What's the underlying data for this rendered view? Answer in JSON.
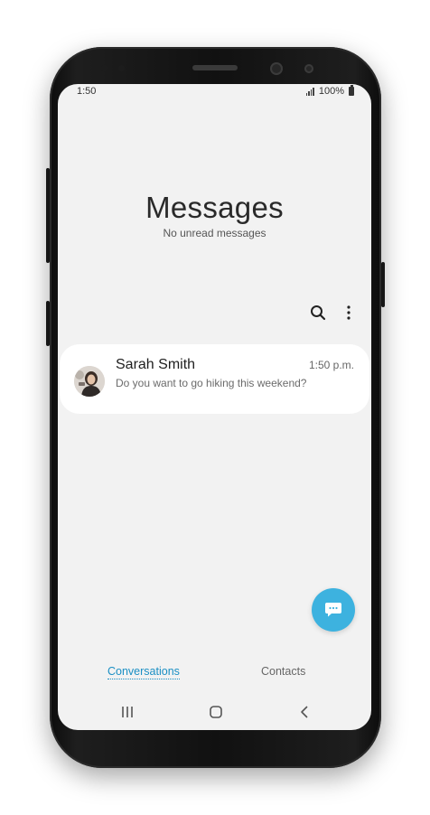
{
  "status_bar": {
    "time": "1:50",
    "battery": "100%"
  },
  "header": {
    "title": "Messages",
    "subtitle": "No unread messages"
  },
  "toolbar": {
    "search_icon": "search-icon",
    "more_icon": "more-vert-icon"
  },
  "conversations": [
    {
      "name": "Sarah Smith",
      "preview": "Do you want to go hiking this weekend?",
      "time": "1:50 p.m."
    }
  ],
  "fab": {
    "icon": "compose-message-icon",
    "color": "#3db2df"
  },
  "tabs": [
    {
      "label": "Conversations",
      "active": true
    },
    {
      "label": "Contacts",
      "active": false
    }
  ],
  "nav_bar": {
    "recent_icon": "recent-apps-icon",
    "home_icon": "home-icon",
    "back_icon": "back-icon"
  },
  "colors": {
    "accent": "#1a8fc4",
    "background": "#f2f2f2",
    "card": "#ffffff"
  }
}
